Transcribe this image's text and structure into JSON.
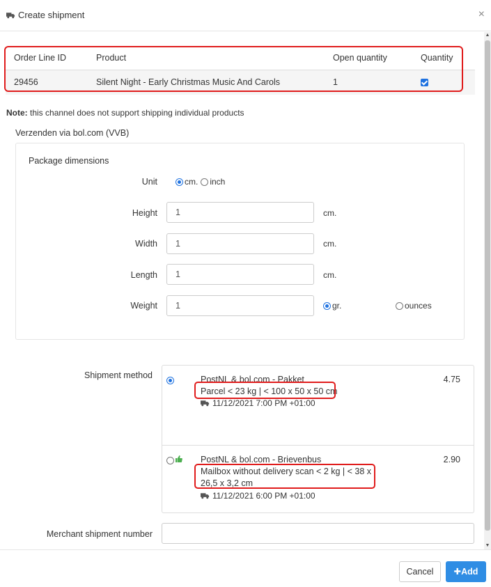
{
  "dialog": {
    "title": "Create shipment",
    "close_label": "×"
  },
  "order_table": {
    "headers": [
      "Order Line ID",
      "Product",
      "Open quantity",
      "Quantity"
    ],
    "rows": [
      {
        "order_line_id": "29456",
        "product": "Silent Night - Early Christmas Music And Carols",
        "open_quantity": "1",
        "quantity_checked": true
      }
    ]
  },
  "note": {
    "prefix": "Note:",
    "text": " this channel does not support shipping individual products"
  },
  "channel_title": "Verzenden via bol.com (VVB)",
  "package": {
    "title": "Package dimensions",
    "unit_label": "Unit",
    "unit_options": [
      "cm.",
      "inch"
    ],
    "unit_selected": "cm.",
    "height_label": "Height",
    "height_value": "1",
    "width_label": "Width",
    "width_value": "1",
    "length_label": "Length",
    "length_value": "1",
    "weight_label": "Weight",
    "weight_value": "1",
    "dim_unit": "cm.",
    "weight_options": [
      "gr.",
      "ounces"
    ],
    "weight_selected": "gr."
  },
  "shipment_method": {
    "label": "Shipment method",
    "options": [
      {
        "name": "PostNL & bol.com - Pakket",
        "description": "Parcel < 23 kg | < 100 x 50 x 50 cm",
        "delivery": "11/12/2021 7:00 PM +01:00",
        "price": "4.75",
        "selected": true,
        "recommended": false
      },
      {
        "name": "PostNL & bol.com - Brievenbus",
        "description": "Mailbox without delivery scan < 2 kg | < 38 x 26,5 x 3,2 cm",
        "delivery": "11/12/2021 6:00 PM +01:00",
        "price": "2.90",
        "selected": false,
        "recommended": true
      }
    ]
  },
  "merchant_shipment_number": {
    "label": "Merchant shipment number",
    "value": ""
  },
  "footer": {
    "cancel_label": "Cancel",
    "add_label": "Add",
    "add_icon": "plus-icon"
  },
  "colors": {
    "primary": "#2f8de4",
    "highlight": "#e01b1b",
    "thumb": "#4caf50"
  }
}
